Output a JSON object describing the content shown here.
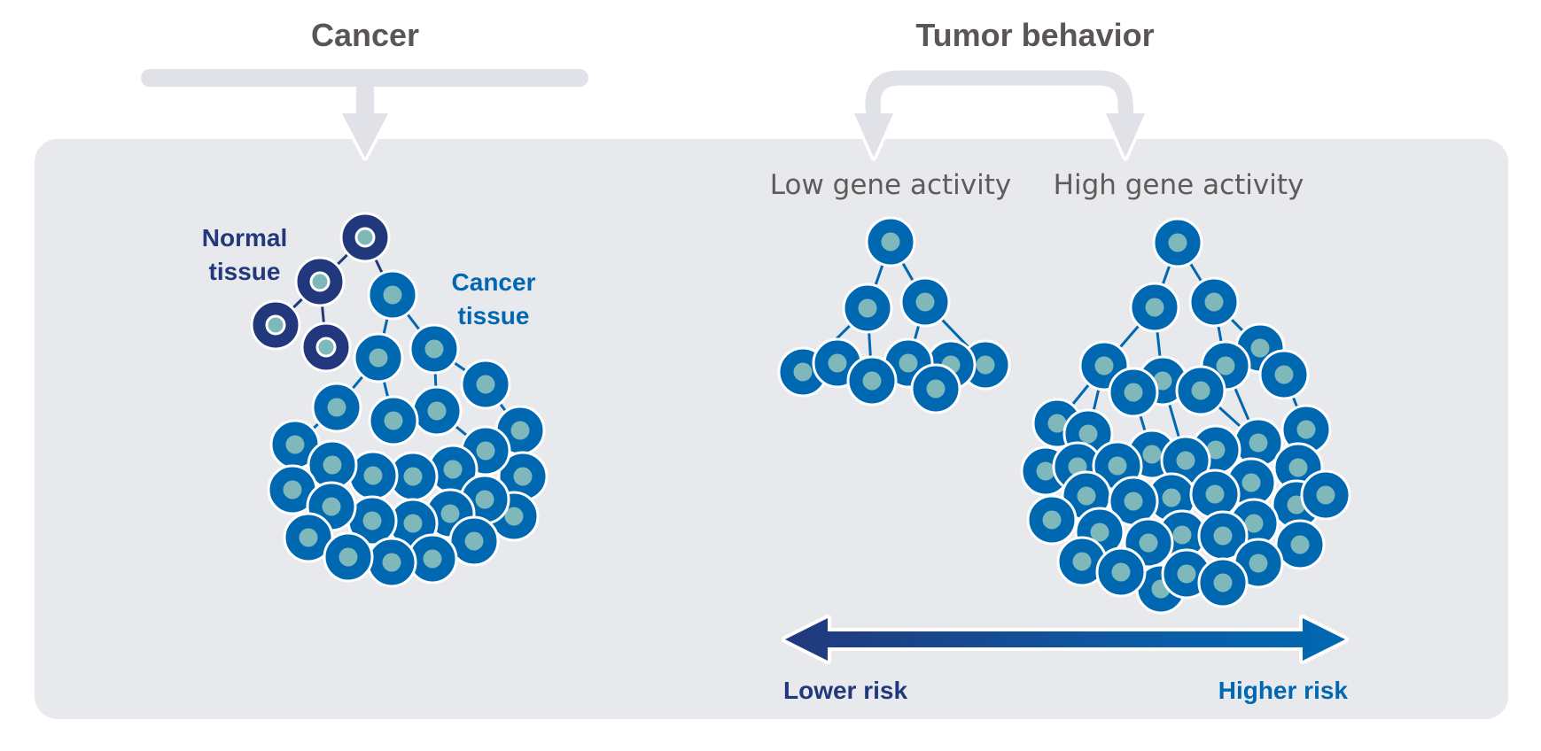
{
  "headings": {
    "cancer": "Cancer",
    "tumor_behavior": "Tumor behavior"
  },
  "subheadings": {
    "low": "Low gene activity",
    "high": "High gene activity"
  },
  "labels": {
    "normal_tissue": [
      "Normal",
      "tissue"
    ],
    "cancer_tissue": [
      "Cancer",
      "tissue"
    ]
  },
  "risk_scale": {
    "lower": "Lower risk",
    "higher": "Higher risk"
  },
  "colors": {
    "panel": "#e8e9ed",
    "connector": "#e1e2e7",
    "heading_text": "#5a5655",
    "normal_cell": "#22387c",
    "cancer_cell": "#0068b1",
    "nucleus": "#7fb8bb",
    "outline": "#ffffff"
  },
  "clusters": {
    "cancer": {
      "normal_cells": [
        [
          412,
          268
        ],
        [
          361,
          318
        ],
        [
          311,
          367
        ],
        [
          368,
          392
        ]
      ],
      "normal_links": [
        [
          0,
          1
        ],
        [
          1,
          2
        ],
        [
          1,
          3
        ],
        [
          0,
          4
        ]
      ],
      "cancer_cells": [
        [
          443,
          333
        ],
        [
          548,
          434
        ],
        [
          490,
          394
        ],
        [
          427,
          404
        ],
        [
          587,
          486
        ],
        [
          380,
          460
        ],
        [
          493,
          464
        ],
        [
          444,
          475
        ],
        [
          333,
          502
        ],
        [
          590,
          538
        ],
        [
          548,
          509
        ],
        [
          511,
          530
        ],
        [
          466,
          538
        ],
        [
          421,
          537
        ],
        [
          375,
          525
        ],
        [
          330,
          553
        ],
        [
          580,
          583
        ],
        [
          547,
          564
        ],
        [
          508,
          580
        ],
        [
          466,
          591
        ],
        [
          420,
          588
        ],
        [
          374,
          572
        ],
        [
          348,
          607
        ],
        [
          535,
          611
        ],
        [
          488,
          631
        ],
        [
          442,
          635
        ],
        [
          393,
          629
        ]
      ],
      "cancer_links": [
        [
          0,
          2
        ],
        [
          0,
          3
        ],
        [
          2,
          1
        ],
        [
          2,
          6
        ],
        [
          3,
          5
        ],
        [
          3,
          7
        ],
        [
          1,
          4
        ],
        [
          5,
          8
        ],
        [
          6,
          10
        ]
      ]
    },
    "low": {
      "cells": [
        [
          1005,
          273
        ],
        [
          979,
          348
        ],
        [
          1044,
          341
        ],
        [
          1112,
          412
        ],
        [
          1073,
          412
        ],
        [
          1025,
          410
        ],
        [
          906,
          420
        ],
        [
          945,
          410
        ],
        [
          1056,
          439
        ],
        [
          984,
          430
        ]
      ],
      "links": [
        [
          0,
          1
        ],
        [
          0,
          2
        ],
        [
          1,
          6
        ],
        [
          1,
          9
        ],
        [
          2,
          5
        ],
        [
          2,
          3
        ]
      ]
    },
    "high": {
      "cells": [
        [
          1329,
          274
        ],
        [
          1303,
          347
        ],
        [
          1370,
          341
        ],
        [
          1422,
          393
        ],
        [
          1449,
          423
        ],
        [
          1383,
          413
        ],
        [
          1246,
          413
        ],
        [
          1312,
          430
        ],
        [
          1355,
          441
        ],
        [
          1279,
          443
        ],
        [
          1193,
          478
        ],
        [
          1228,
          490
        ],
        [
          1474,
          485
        ],
        [
          1420,
          500
        ],
        [
          1300,
          513
        ],
        [
          1372,
          508
        ],
        [
          1338,
          520
        ],
        [
          1180,
          532
        ],
        [
          1216,
          527
        ],
        [
          1261,
          526
        ],
        [
          1465,
          528
        ],
        [
          1412,
          545
        ],
        [
          1226,
          560
        ],
        [
          1322,
          562
        ],
        [
          1279,
          566
        ],
        [
          1371,
          558
        ],
        [
          1463,
          570
        ],
        [
          1496,
          559
        ],
        [
          1415,
          591
        ],
        [
          1187,
          587
        ],
        [
          1241,
          601
        ],
        [
          1334,
          604
        ],
        [
          1296,
          613
        ],
        [
          1380,
          605
        ],
        [
          1467,
          615
        ],
        [
          1221,
          634
        ],
        [
          1420,
          636
        ],
        [
          1310,
          665
        ],
        [
          1339,
          648
        ],
        [
          1265,
          646
        ],
        [
          1380,
          658
        ]
      ],
      "links": [
        [
          0,
          1
        ],
        [
          0,
          2
        ],
        [
          1,
          6
        ],
        [
          1,
          7
        ],
        [
          2,
          5
        ],
        [
          2,
          3
        ],
        [
          6,
          10
        ],
        [
          6,
          11
        ],
        [
          7,
          16
        ],
        [
          5,
          13
        ],
        [
          8,
          13
        ],
        [
          3,
          4
        ],
        [
          4,
          12
        ],
        [
          9,
          14
        ]
      ]
    }
  }
}
